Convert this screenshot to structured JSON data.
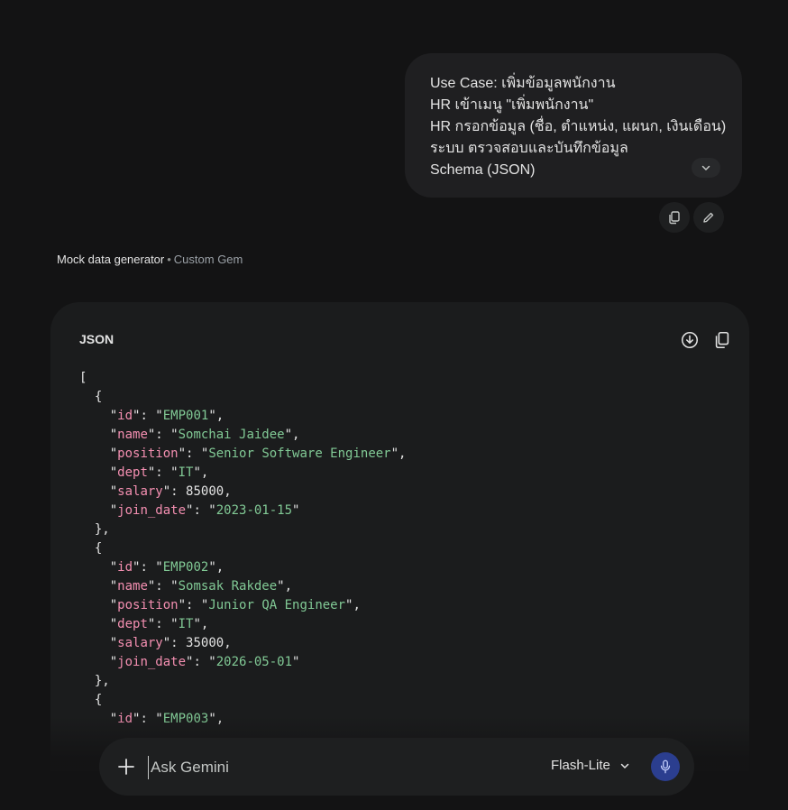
{
  "user_message": {
    "lines": [
      "Use Case: เพิ่มข้อมูลพนักงาน",
      "HR เข้าเมนู \"เพิ่มพนักงาน\"",
      "HR กรอกข้อมูล (ชื่อ, ตำแหน่ง, แผนก, เงินเดือน)",
      "ระบบ ตรวจสอบและบันทึกข้อมูล",
      "Schema (JSON)"
    ]
  },
  "gem": {
    "name": "Mock data generator",
    "separator": "•",
    "type": "Custom Gem"
  },
  "code_block": {
    "language": "JSON",
    "records": [
      {
        "id": "EMP001",
        "name": "Somchai Jaidee",
        "position": "Senior Software Engineer",
        "dept": "IT",
        "salary": "85000",
        "join_date": "2023-01-15"
      },
      {
        "id": "EMP002",
        "name": "Somsak Rakdee",
        "position": "Junior QA Engineer",
        "dept": "IT",
        "salary": "35000",
        "join_date": "2026-05-01"
      },
      {
        "id": "EMP003"
      }
    ]
  },
  "input": {
    "placeholder": "Ask Gemini",
    "model": "Flash-Lite"
  },
  "colors": {
    "background": "#131314",
    "bubble": "#1f1f21",
    "code_key": "#f48fb1",
    "code_string": "#81c995",
    "mic_button": "#2b3e8f"
  },
  "icons": [
    "chevron-down-icon",
    "copy-icon",
    "edit-icon",
    "download-icon",
    "plus-icon",
    "mic-icon"
  ]
}
